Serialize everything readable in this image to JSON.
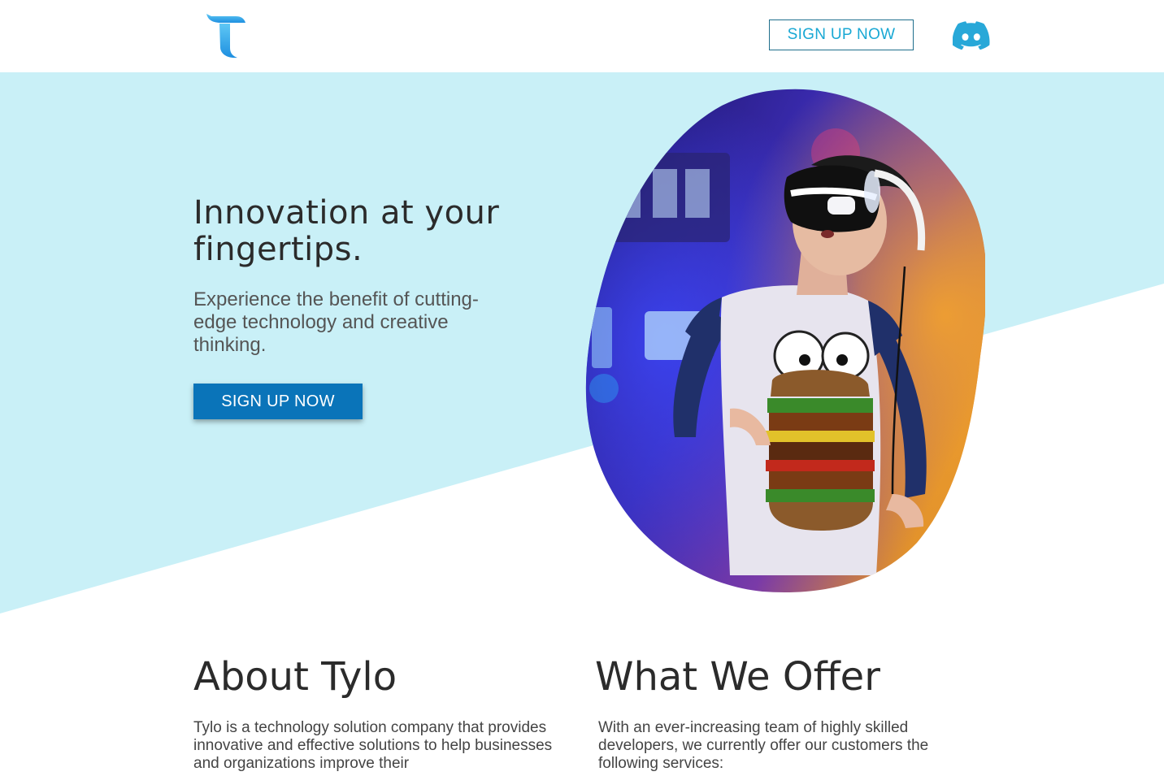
{
  "header": {
    "logo_icon": "tylo-t-logo",
    "signup_label": "SIGN UP NOW",
    "discord_icon": "discord-icon"
  },
  "hero": {
    "title": "Innovation at your fingertips.",
    "subtitle": "Experience the benefit of cutting-edge technology and creative thinking.",
    "signup_label": "SIGN UP NOW",
    "image": "vr-headset-player-photo"
  },
  "about": {
    "title": "About Tylo",
    "text": "Tylo is a technology solution company that provides innovative and effective solutions to help businesses and organizations improve their"
  },
  "offer": {
    "title": "What We Offer",
    "text": "With an ever-increasing team of highly skilled developers, we currently offer our customers the following services:"
  },
  "colors": {
    "hero_background": "#c9f0f7",
    "primary_button": "#0a74b9",
    "accent": "#19a8d4",
    "logo": "#3aaef0"
  }
}
